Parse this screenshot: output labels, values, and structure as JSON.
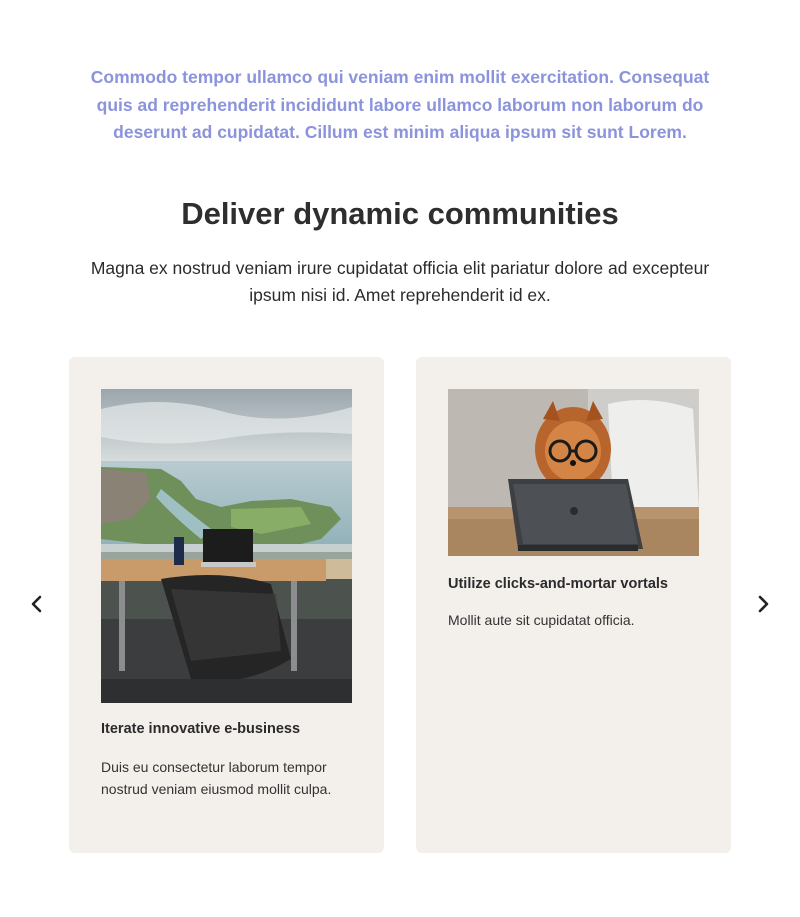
{
  "intro": {
    "text": "Commodo tempor ullamco qui veniam enim mollit exercitation. Consequat quis ad reprehenderit incididunt labore ullamco laborum non laborum do deserunt ad cupidatat. Cillum est minim aliqua ipsum sit sunt Lorem."
  },
  "section": {
    "title": "Deliver dynamic communities",
    "lede": "Magna ex nostrud veniam irure cupidatat officia elit pariatur dolore ad excepteur ipsum nisi id. Amet reprehenderit id ex."
  },
  "carousel": {
    "prev_icon": "chevron-left-icon",
    "next_icon": "chevron-right-icon",
    "cards": [
      {
        "image": "office-desk-city-view-photo",
        "heading": "Iterate innovative e-business",
        "body": "Duis eu consectetur laborum tempor nostrud veniam eiusmod mollit culpa."
      },
      {
        "image": "dog-with-glasses-tablet-photo",
        "heading": "Utilize clicks-and-mortar vortals",
        "body": "Mollit aute sit cupidatat officia."
      }
    ]
  },
  "colors": {
    "intro_text": "#8b93dc",
    "card_background": "#f3f0ec",
    "heading_text": "#2e2e2e"
  }
}
